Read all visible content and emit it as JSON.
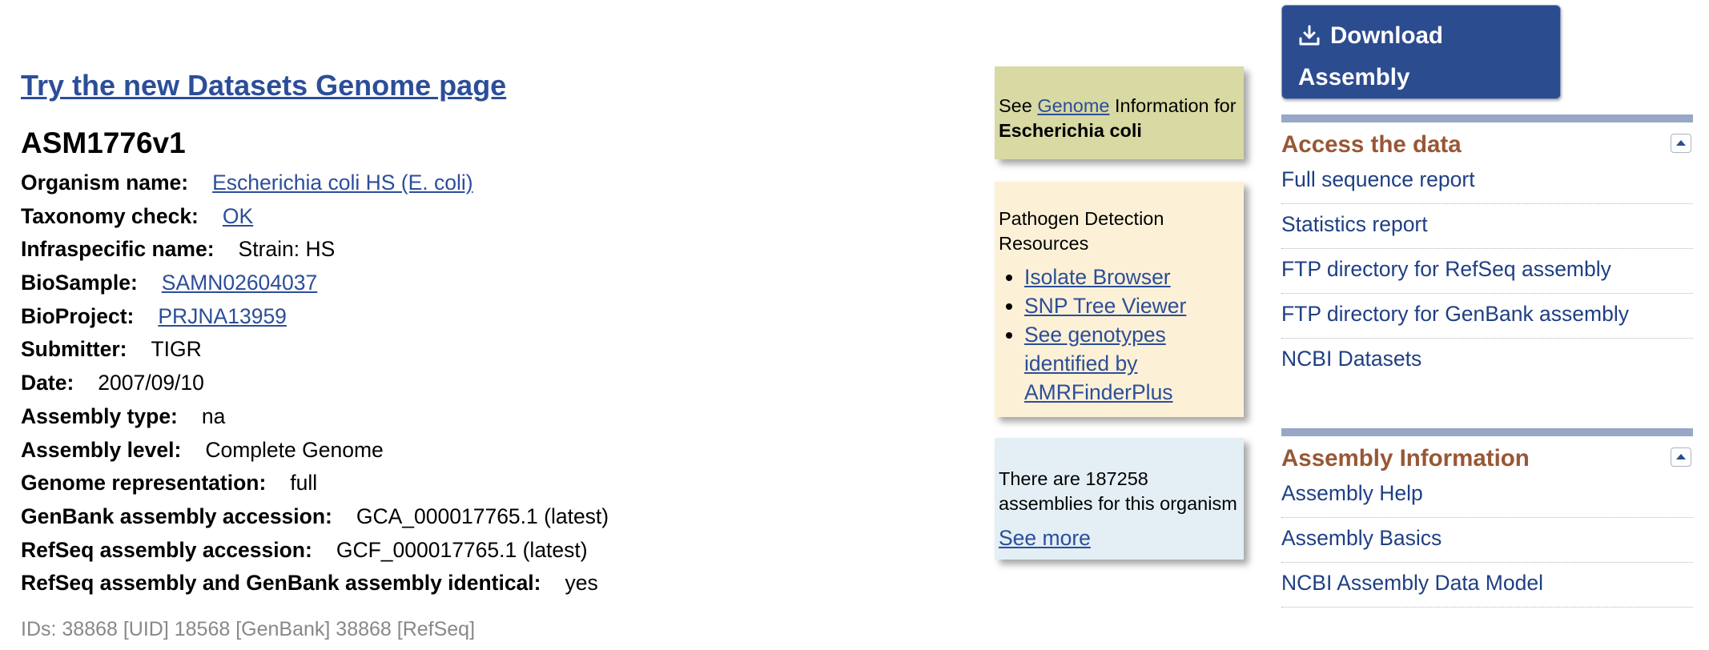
{
  "main": {
    "new_link": "Try the new Datasets Genome page",
    "title": "ASM1776v1",
    "fields": [
      {
        "label": "Organism name:",
        "value": "Escherichia coli HS (E. coli)",
        "link": true
      },
      {
        "label": "Taxonomy check:",
        "value": "OK",
        "link": true
      },
      {
        "label": "Infraspecific name:",
        "value": "Strain: HS",
        "link": false
      },
      {
        "label": "BioSample:",
        "value": "SAMN02604037",
        "link": true
      },
      {
        "label": "BioProject:",
        "value": "PRJNA13959",
        "link": true
      },
      {
        "label": "Submitter:",
        "value": "TIGR",
        "link": false
      },
      {
        "label": "Date:",
        "value": "2007/09/10",
        "link": false
      },
      {
        "label": "Assembly type:",
        "value": "na",
        "link": false
      },
      {
        "label": "Assembly level:",
        "value": "Complete Genome",
        "link": false
      },
      {
        "label": "Genome representation:",
        "value": "full",
        "link": false
      },
      {
        "label": "GenBank assembly accession:",
        "value": "GCA_000017765.1 (latest)",
        "link": false
      },
      {
        "label": "RefSeq assembly accession:",
        "value": "GCF_000017765.1 (latest)",
        "link": false
      },
      {
        "label": "RefSeq assembly and GenBank assembly identical:",
        "value": "yes",
        "link": false
      }
    ],
    "ids": "IDs: 38868 [UID] 18568 [GenBank] 38868 [RefSeq]"
  },
  "genome_box": {
    "prefix": "See",
    "link": "Genome",
    "suffix": "Information for",
    "organism": "Escherichia coli"
  },
  "pathogen_box": {
    "title": "Pathogen Detection Resources",
    "links": [
      "Isolate Browser",
      "SNP Tree Viewer",
      "See genotypes identified by AMRFinderPlus"
    ]
  },
  "count_box": {
    "text": "There are 187258 assemblies for this organism",
    "link": "See more"
  },
  "download": {
    "label": "Download Assembly",
    "icon": "download-icon"
  },
  "access_data": {
    "title": "Access the data",
    "links": [
      "Full sequence report",
      "Statistics report",
      "FTP directory for RefSeq assembly",
      "FTP directory for GenBank assembly",
      "NCBI Datasets"
    ]
  },
  "assembly_info": {
    "title": "Assembly Information",
    "links": [
      "Assembly Help",
      "Assembly Basics",
      "NCBI Assembly Data Model"
    ]
  },
  "colors": {
    "link": "#2c4e99",
    "section_heading": "#985735",
    "button_bg": "#2c4c90",
    "genome_box_bg": "#d8d9a3",
    "pathogen_box_bg": "#fcf1d7",
    "count_box_bg": "#e3eff5"
  }
}
